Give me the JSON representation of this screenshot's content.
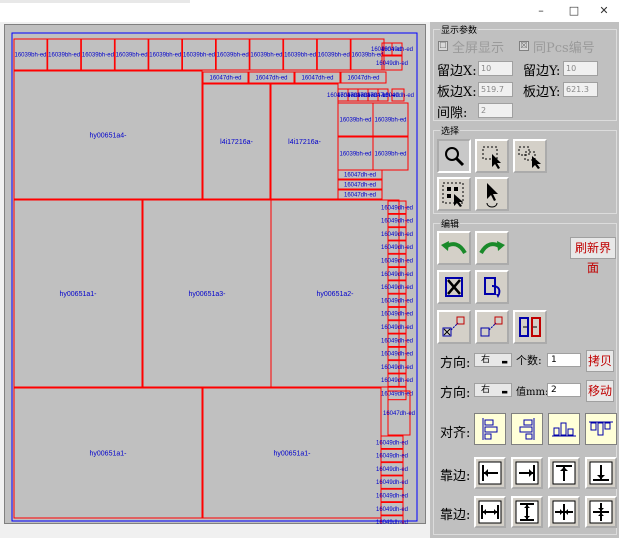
{
  "window": {
    "controls": {
      "minimize": "–",
      "maximize": "□",
      "close": "✕"
    }
  },
  "canvas": {
    "parts": [
      {
        "label": "16039bh-ed"
      },
      {
        "label": "16039bh-ed"
      },
      {
        "label": "16039bh-ed"
      },
      {
        "label": "16039bh-ed"
      },
      {
        "label": "16039bh-ed"
      },
      {
        "label": "16039bh-ed"
      },
      {
        "label": "16039bh-ed"
      },
      {
        "label": "16039bh-ed"
      },
      {
        "label": "16039bh-ed"
      },
      {
        "label": "16039bh-ed"
      },
      {
        "label": "16039bh-ed"
      },
      {
        "label": "16049dh-ed"
      },
      {
        "label": "16049dh-ed"
      },
      {
        "label": "16049dh-ed"
      },
      {
        "label": "16047dh-ed"
      },
      {
        "label": "16047dh-ed"
      },
      {
        "label": "16047dh-ed"
      },
      {
        "label": "16047dh-ed"
      },
      {
        "label": "hy00651a4-"
      },
      {
        "label": "l4i17216a-"
      },
      {
        "label": "l4i17216a-"
      },
      {
        "label": "16047dh-ed"
      },
      {
        "label": "16047dh-ed"
      },
      {
        "label": "16047dh-ed"
      },
      {
        "label": "16047dh-ed"
      },
      {
        "label": "16047dh-ed"
      },
      {
        "label": "16049dh-ed"
      },
      {
        "label": "16039bh-ed"
      },
      {
        "label": "16039bh-ed"
      },
      {
        "label": "16039bh-ed"
      },
      {
        "label": "16039bh-ed"
      },
      {
        "label": "16047dh-ed"
      },
      {
        "label": "16047dh-ed"
      },
      {
        "label": "16047dh-ed"
      },
      {
        "label": "hy00651a1-"
      },
      {
        "label": "hy00651a3-"
      },
      {
        "label": "hy00651a2-"
      },
      {
        "label": "hy00651a1-"
      },
      {
        "label": "hy00651a1-"
      },
      {
        "label": "16049dh-ed"
      },
      {
        "label": "16049dh-ed"
      },
      {
        "label": "16049dh-ed"
      },
      {
        "label": "16049dh-ed"
      },
      {
        "label": "16049dh-ed"
      },
      {
        "label": "16049dh-ed"
      },
      {
        "label": "16049dh-ed"
      },
      {
        "label": "16049dh-ed"
      },
      {
        "label": "16049dh-ed"
      },
      {
        "label": "16049dh-ed"
      },
      {
        "label": "16049dh-ed"
      },
      {
        "label": "16049dh-ed"
      },
      {
        "label": "16049dh-ed"
      },
      {
        "label": "16049dh-ed"
      },
      {
        "label": "16049dh-ed"
      },
      {
        "label": "16047dh-ed"
      },
      {
        "label": "16049dh-ed"
      },
      {
        "label": "16049dh-ed"
      },
      {
        "label": "16049dh-ed"
      },
      {
        "label": "16049dh-ed"
      },
      {
        "label": "16049dh-ed"
      },
      {
        "label": "16049dh-ed"
      },
      {
        "label": "16049dh-ed"
      },
      {
        "label": "16049dh-ed"
      }
    ]
  },
  "display_params": {
    "title": "显示参数",
    "fullscreen_label": "全屏显示",
    "fullscreen_checked": "☐",
    "pcs_label": "同Pcs编号",
    "pcs_checked": "☒",
    "margin_x_label": "留边X:",
    "margin_x_value": "10",
    "margin_y_label": "留边Y:",
    "margin_y_value": "10",
    "board_x_label": "板边X:",
    "board_x_value": "519.7",
    "board_y_label": "板边Y:",
    "board_y_value": "621.3",
    "gap_label": "间隙:",
    "gap_value": "2"
  },
  "select": {
    "title": "选择",
    "tools": [
      "zoom-icon",
      "select-region-icon",
      "select-multi-icon",
      "select-grid-icon",
      "pointer-rotate-icon"
    ]
  },
  "edit": {
    "title": "编辑",
    "refresh_label": "刷新界面",
    "direction1_label": "方向:",
    "direction1_value": "右",
    "count_label": "个数:",
    "count_value": "1",
    "copy_label": "拷贝",
    "direction2_label": "方向:",
    "direction2_value": "右",
    "distance_label": "值mm:",
    "distance_value": "2",
    "move_label": "移动",
    "align_label": "对齐:",
    "edge1_label": "靠边:",
    "edge2_label": "靠边:"
  },
  "colors": {
    "part_outline": "#ff0000",
    "board_outline": "#0000ff",
    "label_text": "#0000cc",
    "accent_red": "#c00000"
  }
}
